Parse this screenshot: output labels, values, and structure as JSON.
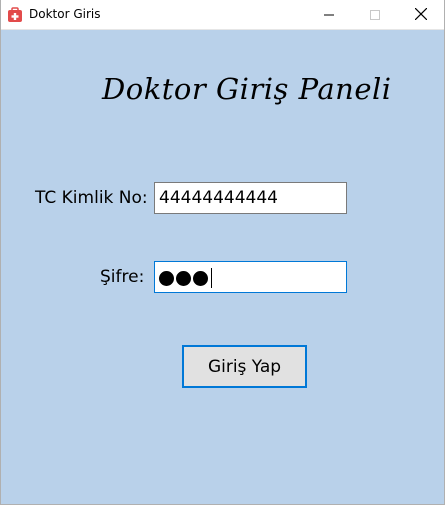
{
  "window": {
    "title": "Doktor Giris",
    "icon": "medical-bag-icon",
    "controls": [
      "minimize-icon",
      "maximize-icon",
      "close-icon"
    ]
  },
  "form": {
    "heading": "Doktor Giriş Paneli",
    "tc_label": "TC Kimlik No:",
    "tc_value": "44444444444",
    "password_label": "Şifre:",
    "password_masked_count": 3,
    "login_button": "Giriş Yap"
  },
  "colors": {
    "background": "#b9d1ea",
    "accent": "#0078d7",
    "button": "#e1e1e1",
    "icon_red": "#e24b4b"
  }
}
